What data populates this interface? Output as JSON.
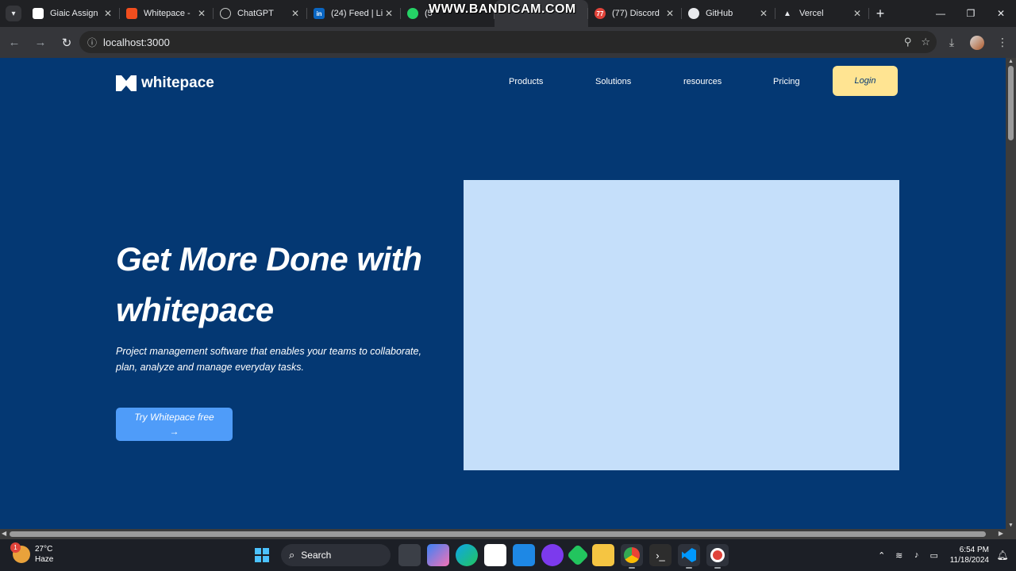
{
  "browser": {
    "watermark": "WWW.BANDICAM.COM",
    "tabs": [
      {
        "title": "Giaic Assign",
        "favicon": "doc-favicon",
        "color": "#ffffff"
      },
      {
        "title": "Whitepace -",
        "favicon": "figma-favicon",
        "color": "#f24e1e"
      },
      {
        "title": "ChatGPT",
        "favicon": "chatgpt-favicon",
        "color": "#202124"
      },
      {
        "title": "(24) Feed | Li",
        "favicon": "linkedin-favicon",
        "color": "#0a66c2"
      },
      {
        "title": "(5",
        "favicon": "whatsapp-favicon",
        "color": "#25d366"
      },
      {
        "title": "",
        "favicon": "vercel-favicon",
        "color": "#35363a"
      },
      {
        "title": "(77) Discord",
        "favicon": "discord-favicon",
        "color": "#e0433a"
      },
      {
        "title": "GitHub",
        "favicon": "github-favicon",
        "color": "#202124"
      },
      {
        "title": "Vercel",
        "favicon": "vercel-favicon",
        "color": "#202124"
      }
    ],
    "url": "localhost:3000"
  },
  "site": {
    "brand": "whitepace",
    "nav": [
      "Products",
      "Solutions",
      "resources",
      "Pricing"
    ],
    "login": "Login",
    "hero_title": "Get More Done with whitepace",
    "hero_subtitle": "Project management software that enables your teams to collaborate, plan, analyze and manage everyday tasks.",
    "cta_label": "Try Whitepace free",
    "cta_arrow": "→",
    "colors": {
      "background": "#043873",
      "accent": "#4f9cf9",
      "login": "#ffe492",
      "image_placeholder": "#c5dffa"
    }
  },
  "taskbar": {
    "weather_alert": "1",
    "temperature": "27°C",
    "condition": "Haze",
    "search_label": "Search",
    "time": "6:54 PM",
    "date": "11/18/2024"
  }
}
